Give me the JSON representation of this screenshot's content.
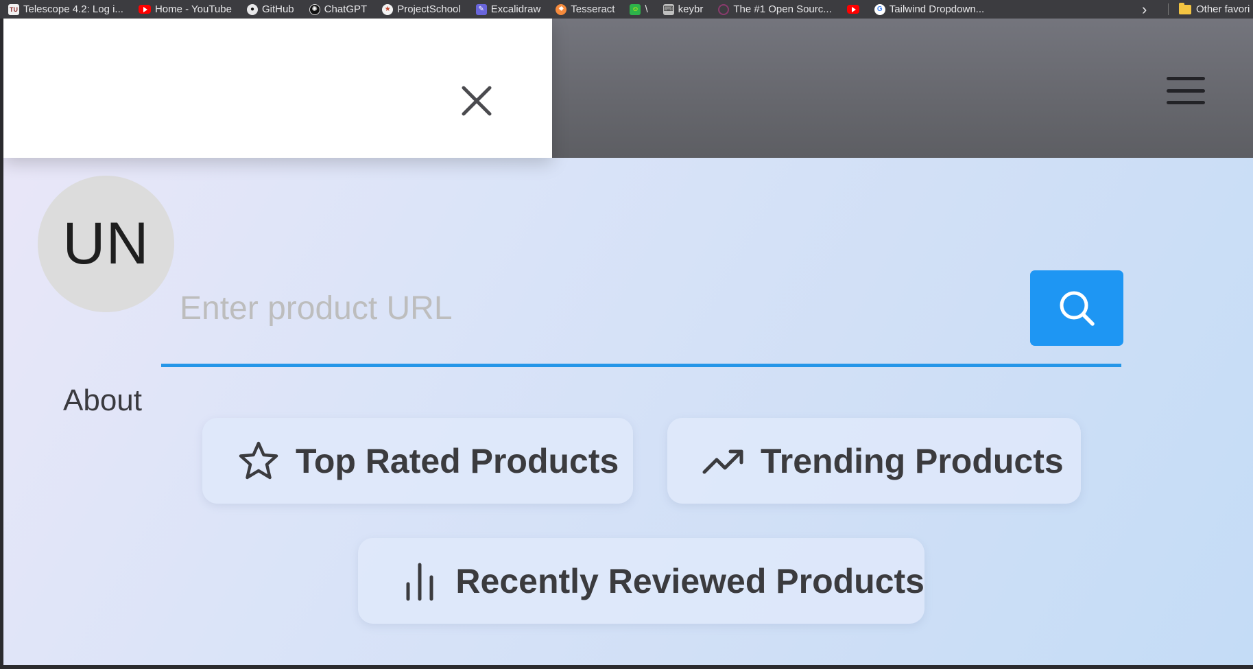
{
  "bookmarks": [
    {
      "label": "Telescope 4.2: Log i...",
      "icon": "tu-icon",
      "glyph": "TU"
    },
    {
      "label": "Home - YouTube",
      "icon": "youtube-icon",
      "glyph": ""
    },
    {
      "label": "GitHub",
      "icon": "github-icon",
      "glyph": "●"
    },
    {
      "label": "ChatGPT",
      "icon": "chatgpt-icon",
      "glyph": "✺"
    },
    {
      "label": "ProjectSchool",
      "icon": "projectschool-icon",
      "glyph": "★"
    },
    {
      "label": "Excalidraw",
      "icon": "excalidraw-icon",
      "glyph": "✎"
    },
    {
      "label": "Tesseract",
      "icon": "tesseract-icon",
      "glyph": "✸"
    },
    {
      "label": "\\",
      "icon": "smiley-icon",
      "glyph": "☺"
    },
    {
      "label": "keybr",
      "icon": "keybr-icon",
      "glyph": "⌨"
    },
    {
      "label": "The #1 Open Sourc...",
      "icon": "opensource-icon",
      "glyph": ""
    },
    {
      "label": "",
      "icon": "youtube-icon",
      "glyph": ""
    },
    {
      "label": "Tailwind Dropdown...",
      "icon": "google-icon",
      "glyph": "G"
    }
  ],
  "bookmarks_overflow": "›",
  "other_favorites": "Other favori",
  "avatar": {
    "initials": "UN"
  },
  "search": {
    "placeholder": "Enter product URL",
    "value": ""
  },
  "nav": {
    "about": "About"
  },
  "chips": {
    "top_rated": "Top Rated Products",
    "trending": "Trending Products",
    "recent": "Recently Reviewed Products"
  },
  "colors": {
    "accent": "#1e96f3",
    "underline": "#2596e8",
    "avatar_bg": "#dcdcdc"
  }
}
